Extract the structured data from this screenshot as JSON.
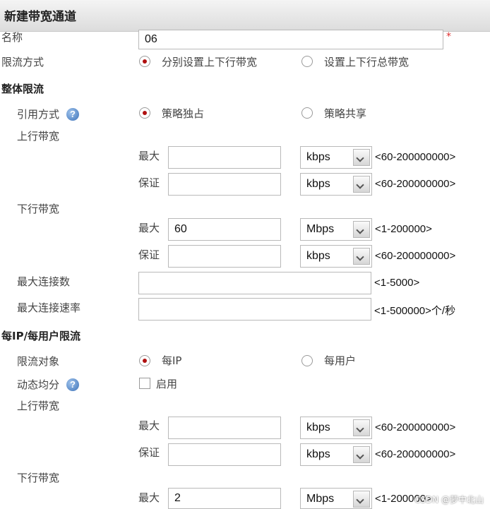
{
  "header": {
    "title": "新建带宽通道"
  },
  "name_row": {
    "label": "名称",
    "value": "06",
    "required": "*"
  },
  "limit_mode": {
    "label": "限流方式",
    "options": [
      "分别设置上下行带宽",
      "设置上下行总带宽"
    ],
    "selected": 0
  },
  "overall": {
    "title": "整体限流",
    "ref_mode": {
      "label": "引用方式",
      "options": [
        "策略独占",
        "策略共享"
      ],
      "selected": 0
    },
    "upstream": {
      "label": "上行带宽",
      "max": {
        "label": "最大",
        "value": "",
        "unit": "kbps",
        "range": "<60-200000000>"
      },
      "guarantee": {
        "label": "保证",
        "value": "",
        "unit": "kbps",
        "range": "<60-200000000>"
      }
    },
    "downstream": {
      "label": "下行带宽",
      "max": {
        "label": "最大",
        "value": "60",
        "unit": "Mbps",
        "range": "<1-200000>"
      },
      "guarantee": {
        "label": "保证",
        "value": "",
        "unit": "kbps",
        "range": "<60-200000000>"
      }
    },
    "max_connections": {
      "label": "最大连接数",
      "value": "",
      "range": "<1-5000>"
    },
    "max_conn_rate": {
      "label": "最大连接速率",
      "value": "",
      "range": "<1-500000>个/秒"
    }
  },
  "per_ip": {
    "title": "每IP/每用户限流",
    "target": {
      "label": "限流对象",
      "options": [
        "每IP",
        "每用户"
      ],
      "selected": 0
    },
    "dynamic": {
      "label": "动态均分",
      "checkbox_label": "启用",
      "checked": false
    },
    "upstream": {
      "label": "上行带宽",
      "max": {
        "label": "最大",
        "value": "",
        "unit": "kbps",
        "range": "<60-200000000>"
      },
      "guarantee": {
        "label": "保证",
        "value": "",
        "unit": "kbps",
        "range": "<60-200000000>"
      }
    },
    "downstream": {
      "label": "下行带宽",
      "max": {
        "label": "最大",
        "value": "2",
        "unit": "Mbps",
        "range": "<1-200000>"
      }
    }
  },
  "icons": {
    "help": "help-icon",
    "dropdown": "chevron-down-icon",
    "help_glyph": "?"
  },
  "watermark": "CSDN @萝中北山",
  "colors": {
    "radio_checked": "#b01010",
    "required": "#e03030",
    "help": "#3d72b8"
  }
}
